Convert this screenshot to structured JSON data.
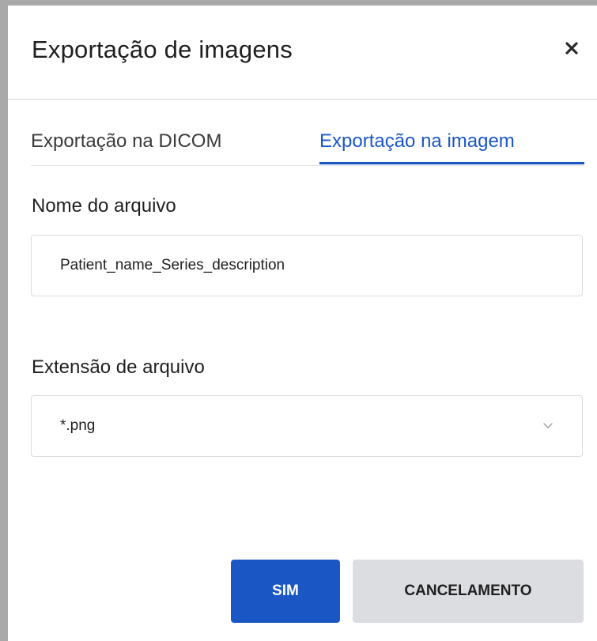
{
  "dialog": {
    "title": "Exportação de imagens",
    "close_icon": "close-icon"
  },
  "tabs": [
    {
      "label": "Exportação na DICOM",
      "active": false
    },
    {
      "label": "Exportação na imagem",
      "active": true
    }
  ],
  "form": {
    "filename_label": "Nome do arquivo",
    "filename_value": "Patient_name_Series_description",
    "extension_label": "Extensão de arquivo",
    "extension_value": "*.png",
    "extension_icon": "chevron-down-icon"
  },
  "buttons": {
    "yes_label": "SIM",
    "cancel_label": "CANCELAMENTO"
  },
  "colors": {
    "accent": "#1a57c4",
    "cancel_bg": "#dcdde1",
    "backdrop": "#a9a9a9"
  }
}
